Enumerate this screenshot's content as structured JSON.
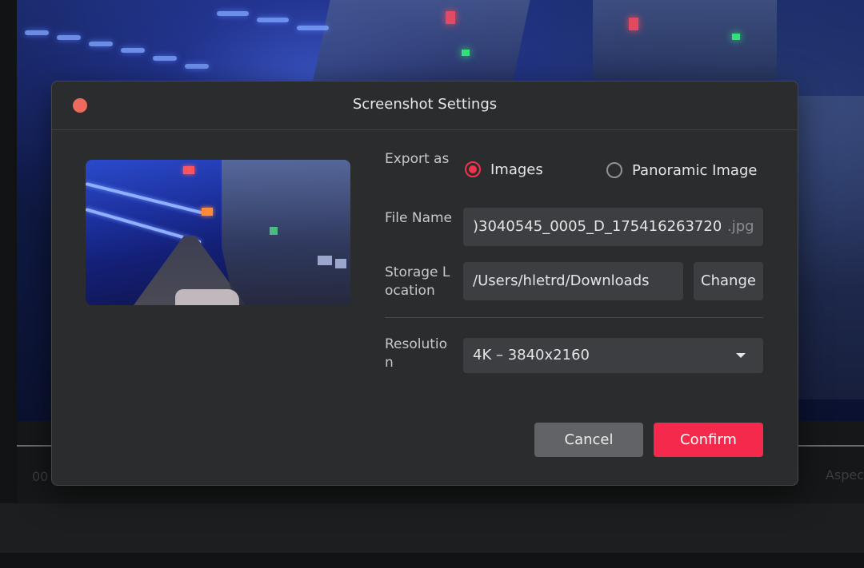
{
  "background": {
    "time_partial": "00",
    "aspect_partial": "Aspec"
  },
  "dialog": {
    "title": "Screenshot Settings",
    "export": {
      "label": "Export as",
      "options": [
        {
          "label": "Images",
          "selected": true
        },
        {
          "label": "Panoramic Image",
          "selected": false
        }
      ]
    },
    "file_name": {
      "label": "File Name",
      "value": ")3040545_0005_D_1754162637200",
      "extension": ".jpg"
    },
    "storage": {
      "label": "Storage Location",
      "path": "/Users/hletrd/Downloads",
      "change_label": "Change"
    },
    "resolution": {
      "label": "Resolution",
      "selected": "4K – 3840x2160"
    },
    "buttons": {
      "cancel": "Cancel",
      "confirm": "Confirm"
    }
  },
  "colors": {
    "accent": "#f4294b",
    "close_dot": "#ef6a5e",
    "dialog_bg": "#2b2c2e",
    "field_bg": "#3d3e41"
  },
  "icons": {
    "close": "close-dot-icon",
    "dropdown": "chevron-down-icon"
  }
}
